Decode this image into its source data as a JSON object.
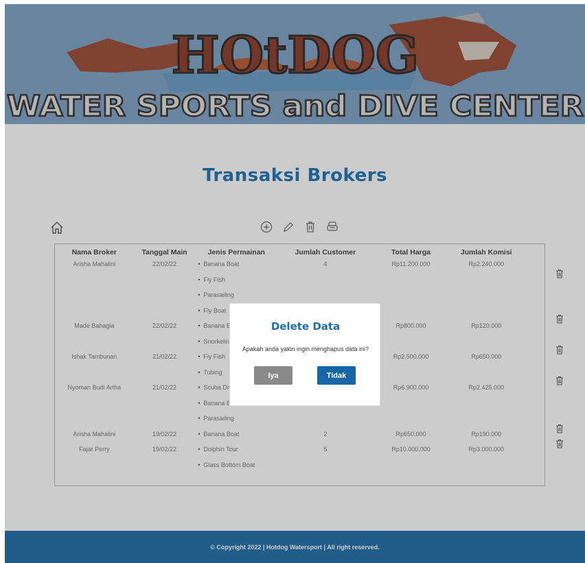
{
  "banner": {
    "logo_top": "HOtDOG",
    "logo_bottom": "WATER SPORTS and DIVE CENTER"
  },
  "page": {
    "title": "Transaksi Brokers"
  },
  "table": {
    "headers": [
      "Nama Broker",
      "Tanggal Main",
      "Jenis Permainan",
      "Jumlah Customer",
      "Total Harga",
      "Jumlah Komisi"
    ],
    "rows": [
      {
        "nama": "Arisha Mahalini",
        "tanggal": "22/02/22",
        "jenis": [
          "Banana Boat",
          "Fly Fish",
          "Parasailing",
          "Fly Boat"
        ],
        "customer": "4",
        "total": "Rp11.200.000",
        "komisi": "Rp2.240.000"
      },
      {
        "nama": "Made Bahagia",
        "tanggal": "22/02/22",
        "jenis": [
          "Banana Boat",
          "Snorkeling"
        ],
        "customer": "",
        "total": "Rp800.000",
        "komisi": "Rp120.000"
      },
      {
        "nama": "Ishak Tambunan",
        "tanggal": "21/02/22",
        "jenis": [
          "Fly Fish",
          "Tubing"
        ],
        "customer": "",
        "total": "Rp2.500.000",
        "komisi": "Rp650.000"
      },
      {
        "nama": "Nyoman Budi Artha",
        "tanggal": "21/02/22",
        "jenis": [
          "Scuba Diving",
          "Banana Boat",
          "Parasailing"
        ],
        "customer": "",
        "total": "Rp6.900.000",
        "komisi": "Rp2.425.000"
      },
      {
        "nama": "Arisha Mahalini",
        "tanggal": "19/02/22",
        "jenis": [
          "Banana Boat"
        ],
        "customer": "2",
        "total": "Rp650.000",
        "komisi": "Rp190.000"
      },
      {
        "nama": "Fajar Perry",
        "tanggal": "19/02/22",
        "jenis": [
          "Dolphin Tour",
          "Glass Bottom Boat"
        ],
        "customer": "5",
        "total": "Rp10.000.000",
        "komisi": "Rp3.000.000"
      }
    ]
  },
  "footer": {
    "text": "© Copyright 2022 | Hotdog Watersport | All right reserved."
  },
  "modal": {
    "title": "Delete Data",
    "message": "Apakah anda yakin ingin menghapus data ini?",
    "yes_label": "Iya",
    "no_label": "Tidak"
  },
  "icons": {
    "home": "home-icon",
    "add": "plus-circle-icon",
    "edit": "pencil-icon",
    "delete": "trash-icon",
    "print": "printer-icon"
  },
  "colors": {
    "banner_bg": "#7fa2c4",
    "title": "#1e73b6",
    "footer_bg": "#1d6fa8",
    "btn_yes": "#8a8a8a",
    "btn_no": "#1665a5"
  }
}
